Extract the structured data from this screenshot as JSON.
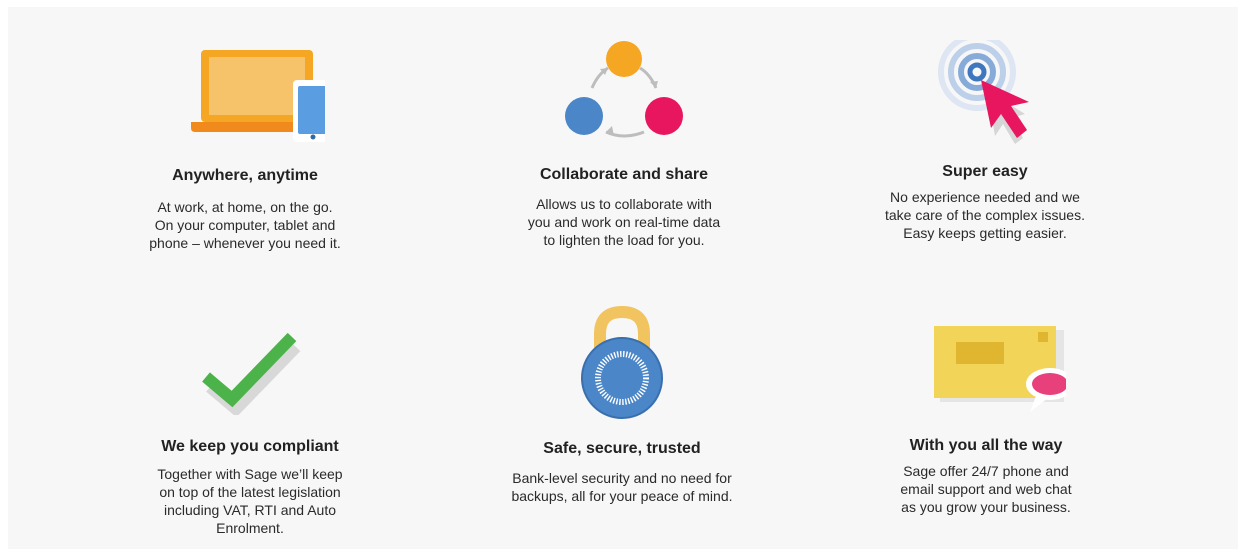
{
  "colors": {
    "orange": "#f5a623",
    "red": "#e8155f",
    "blue": "#4a86c8",
    "green": "#4cb24a",
    "yellow": "#f1d458",
    "pink": "#e8407a"
  },
  "features": [
    {
      "icon": "laptop-tablet-icon",
      "title": "Anywhere, anytime",
      "lines": [
        "At work, at home, on the go.",
        "On your computer, tablet and",
        "phone – whenever you need it."
      ]
    },
    {
      "icon": "collaborate-cycle-icon",
      "title": "Collaborate and share",
      "lines": [
        "Allows us to collaborate with",
        "you and work on real-time data",
        "to lighten the load for you."
      ]
    },
    {
      "icon": "target-cursor-icon",
      "title": "Super easy",
      "lines": [
        "No experience needed and we",
        "take care of the complex issues.",
        "Easy keeps getting easier."
      ]
    },
    {
      "icon": "checkmark-icon",
      "title": "We keep you compliant",
      "lines": [
        "Together with Sage we’ll keep",
        "on top of the latest legislation",
        "including VAT, RTI and Auto",
        "Enrolment."
      ]
    },
    {
      "icon": "padlock-icon",
      "title": "Safe, secure, trusted",
      "lines": [
        "Bank-level security and no need for",
        "backups, all for your peace of mind."
      ]
    },
    {
      "icon": "envelope-chat-icon",
      "title": "With you all the way",
      "lines": [
        "Sage offer 24/7 phone and",
        "email support and web chat",
        "as you grow your business."
      ]
    }
  ]
}
